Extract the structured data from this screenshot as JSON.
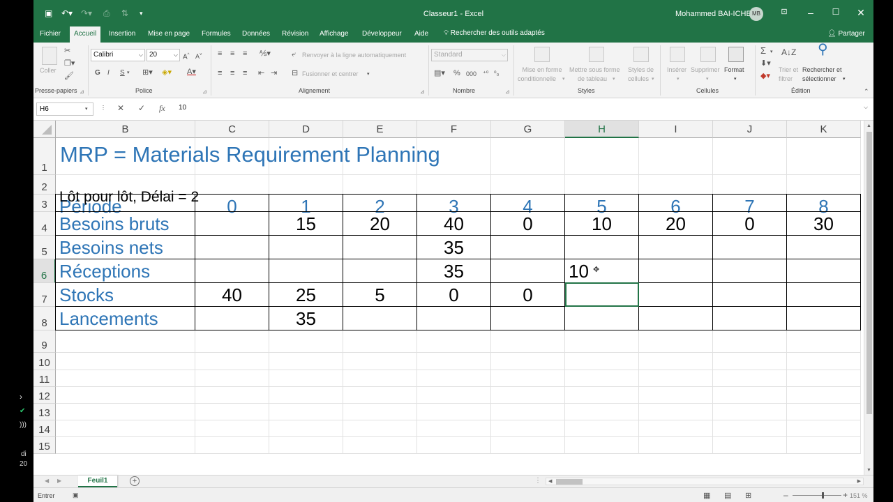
{
  "window": {
    "doc_title": "Classeur1  -  Excel",
    "user_name": "Mohammed BAI-ICHE",
    "user_initials": "MB"
  },
  "tabs": {
    "items": [
      "Fichier",
      "Accueil",
      "Insertion",
      "Mise en page",
      "Formules",
      "Données",
      "Révision",
      "Affichage",
      "Développeur",
      "Aide"
    ],
    "active": "Accueil",
    "tell_me": "Rechercher des outils adaptés",
    "share": "Partager"
  },
  "ribbon": {
    "clipboard": {
      "paste": "Coller",
      "label": "Presse-papiers"
    },
    "font": {
      "name": "Calibri",
      "size": "20",
      "bold": "G",
      "italic": "I",
      "underline": "S",
      "grow": "A^",
      "shrink": "A˅",
      "font_color_letter": "A",
      "label": "Police"
    },
    "alignment": {
      "wrap": "Renvoyer à la ligne automatiquement",
      "merge": "Fusionner et centrer",
      "label": "Alignement"
    },
    "number": {
      "format": "Standard",
      "percent": "%",
      "comma": "000",
      "label": "Nombre"
    },
    "styles": {
      "conditional_1": "Mise en forme",
      "conditional_2": "conditionnelle",
      "table_1": "Mettre sous forme",
      "table_2": "de tableau",
      "cell_styles_1": "Styles de",
      "cell_styles_2": "cellules",
      "label": "Styles"
    },
    "cells": {
      "insert": "Insérer",
      "delete": "Supprimer",
      "format": "Format",
      "label": "Cellules"
    },
    "editing": {
      "sum": "Σ",
      "sort_1": "Trier et",
      "sort_2": "filtrer",
      "find_1": "Rechercher et",
      "find_2": "sélectionner",
      "label": "Édition"
    }
  },
  "formula_bar": {
    "name_box": "H6",
    "cancel": "✕",
    "enter": "✓",
    "fx": "fx",
    "value": "10"
  },
  "sheet": {
    "columns": [
      "B",
      "C",
      "D",
      "E",
      "F",
      "G",
      "H",
      "I",
      "J",
      "K"
    ],
    "selected_column": "H",
    "rows": [
      "1",
      "2",
      "3",
      "4",
      "5",
      "6",
      "7",
      "8",
      "9",
      "10",
      "11",
      "12",
      "13",
      "14",
      "15"
    ],
    "selected_row": "6",
    "title": "MRP = Materials Requirement Planning",
    "subtitle": "Lôt pour lôt, Délai = 2",
    "table": {
      "header_label": "Période",
      "periods": [
        "0",
        "1",
        "2",
        "3",
        "4",
        "5",
        "6",
        "7",
        "8"
      ],
      "rows": [
        {
          "label": "Besoins bruts",
          "values": [
            "",
            "15",
            "20",
            "40",
            "0",
            "10",
            "20",
            "0",
            "30"
          ]
        },
        {
          "label": "Besoins nets",
          "values": [
            "",
            "",
            "",
            "35",
            "",
            "",
            "",
            "",
            ""
          ]
        },
        {
          "label": "Réceptions",
          "values": [
            "",
            "",
            "",
            "35",
            "",
            "10",
            "",
            "",
            ""
          ]
        },
        {
          "label": "Stocks",
          "values": [
            "40",
            "25",
            "5",
            "0",
            "0",
            "",
            "",
            "",
            ""
          ]
        },
        {
          "label": "Lancements",
          "values": [
            "",
            "35",
            "",
            "",
            "",
            "",
            "",
            "",
            ""
          ]
        }
      ]
    },
    "editing_cell_value": "10",
    "header_color": "#2e75b6",
    "accent_color": "#217346"
  },
  "sheet_tabs": {
    "active": "Feuil1",
    "add": "+"
  },
  "status": {
    "mode": "Entrer",
    "zoom": "151 %"
  },
  "left_strip": {
    "line1": "di",
    "line2": "20"
  }
}
